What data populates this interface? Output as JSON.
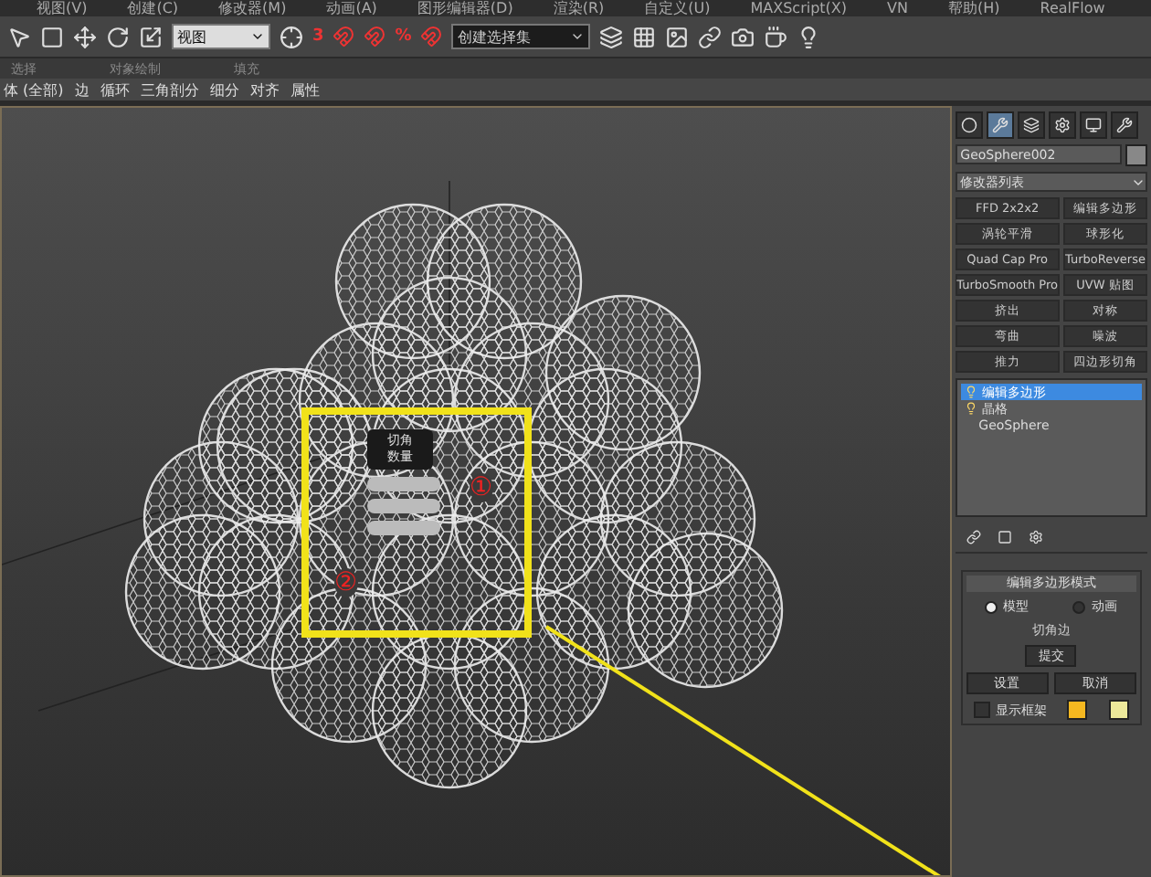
{
  "menu": [
    "视图(V)",
    "创建(C)",
    "修改器(M)",
    "动画(A)",
    "图形编辑器(D)",
    "渲染(R)",
    "自定义(U)",
    "MAXScript(X)",
    "VN",
    "帮助(H)",
    "RealFlow"
  ],
  "toolbar": {
    "view_dropdown": "视图",
    "snap_label": "3",
    "percent_label": "%",
    "selection_set": "创建选择集"
  },
  "ribbon_tabs": [
    "选择",
    "对象绘制",
    "填充"
  ],
  "ribbon_tools": [
    "体 (全部)",
    "边",
    "循环",
    "三角剖分",
    "细分",
    "对齐",
    "属性"
  ],
  "viewport": {
    "caddy": {
      "title": "切角",
      "field_label": "数量"
    },
    "annotations": [
      "①",
      "②"
    ]
  },
  "panel": {
    "command_tabs": [
      {
        "selected": false
      },
      {
        "selected": true
      },
      {
        "selected": false
      },
      {
        "selected": false
      },
      {
        "selected": false
      },
      {
        "selected": false
      }
    ],
    "object_name": "GeoSphere002",
    "modifier_list": "修改器列表",
    "modifier_buttons": [
      "FFD 2x2x2",
      "编辑多边形",
      "涡轮平滑",
      "球形化",
      "Quad Cap Pro",
      "TurboReverse",
      "TurboSmooth Pro",
      "UVW 贴图",
      "挤出",
      "对称",
      "弯曲",
      "噪波",
      "推力",
      "四边形切角"
    ],
    "stack": [
      {
        "label": "编辑多边形",
        "selected": true,
        "kind": "modifier"
      },
      {
        "label": "晶格",
        "selected": false,
        "kind": "modifier"
      },
      {
        "label": "GeoSphere",
        "selected": false,
        "kind": "base"
      }
    ],
    "rollout": {
      "title": "编辑多边形模式",
      "modes": [
        {
          "label": "模型",
          "selected": true
        },
        {
          "label": "动画",
          "selected": false
        }
      ],
      "operation": "切角边",
      "commit": "提交",
      "settings": "设置",
      "cancel": "取消",
      "show_cage": {
        "label": "显示框架",
        "checked": false
      },
      "cage_colors": [
        {
          "color": "#f5b820"
        },
        {
          "color": "#ece89a"
        }
      ]
    }
  }
}
